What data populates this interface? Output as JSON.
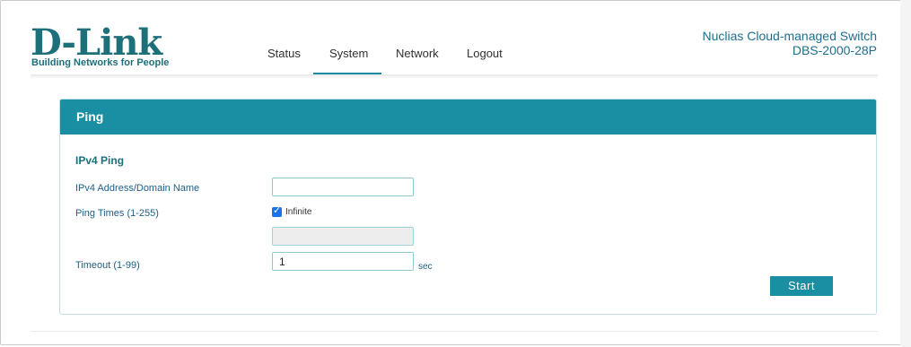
{
  "logo": {
    "brand": "D-Link",
    "tagline": "Building Networks for People"
  },
  "nav": {
    "items": [
      "Status",
      "System",
      "Network",
      "Logout"
    ],
    "active": "System"
  },
  "product": {
    "line1": "Nuclias Cloud-managed Switch",
    "line2": "DBS-2000-28P"
  },
  "panel": {
    "title": "Ping",
    "section": "IPv4 Ping",
    "fields": {
      "address_label": "IPv4 Address/Domain Name",
      "address_value": "",
      "ping_times_label": "Ping Times (1-255)",
      "infinite_label": "Infinite",
      "infinite_checked": true,
      "ping_times_value": "",
      "timeout_label": "Timeout (1-99)",
      "timeout_value": "1",
      "timeout_unit": "sec"
    },
    "start_label": "Start"
  },
  "colors": {
    "accent": "#1a8fa3",
    "brand": "#1d6f7a",
    "label": "#1d5f86"
  }
}
